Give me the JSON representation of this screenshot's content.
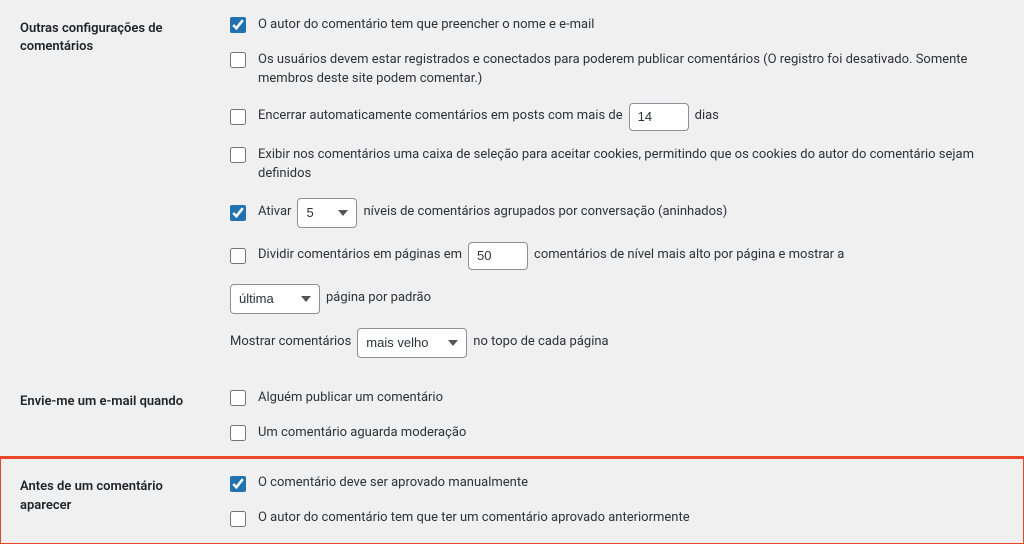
{
  "sections": {
    "other_settings": {
      "title": "Outras configurações de comentários",
      "author_must_fill": {
        "checked": true,
        "label": "O autor do comentário tem que preencher o nome e e-mail"
      },
      "users_must_register": {
        "checked": false,
        "label": "Os usuários devem estar registrados e conectados para poderem publicar comentários (O registro foi desativado. Somente membros deste site podem comentar.)"
      },
      "auto_close": {
        "checked": false,
        "before": "Encerrar automaticamente comentários em posts com mais de",
        "value": "14",
        "after": "dias"
      },
      "cookies_optin": {
        "checked": false,
        "label": "Exibir nos comentários uma caixa de seleção para aceitar cookies, permitindo que os cookies do autor do comentário sejam definidos"
      },
      "thread": {
        "checked": true,
        "before": "Ativar",
        "value": "5",
        "after": "níveis de comentários agrupados por conversação (aninhados)"
      },
      "paginate": {
        "checked": false,
        "before": "Dividir comentários em páginas em",
        "value": "50",
        "after": "comentários de nível mais alto por página e mostrar a"
      },
      "page_default": {
        "value": "última",
        "after": "página por padrão"
      },
      "show_order": {
        "before": "Mostrar comentários",
        "value": "mais velho",
        "after": "no topo de cada página"
      }
    },
    "email_me": {
      "title": "Envie-me um e-mail quando",
      "on_publish": {
        "checked": false,
        "label": "Alguém publicar um comentário"
      },
      "on_moderation": {
        "checked": false,
        "label": "Um comentário aguarda moderação"
      }
    },
    "before_appear": {
      "title": "Antes de um comentário aparecer",
      "manual_approve": {
        "checked": true,
        "label": "O comentário deve ser aprovado manualmente"
      },
      "prev_approved": {
        "checked": false,
        "label": "O autor do comentário tem que ter um comentário aprovado anteriormente"
      }
    }
  }
}
